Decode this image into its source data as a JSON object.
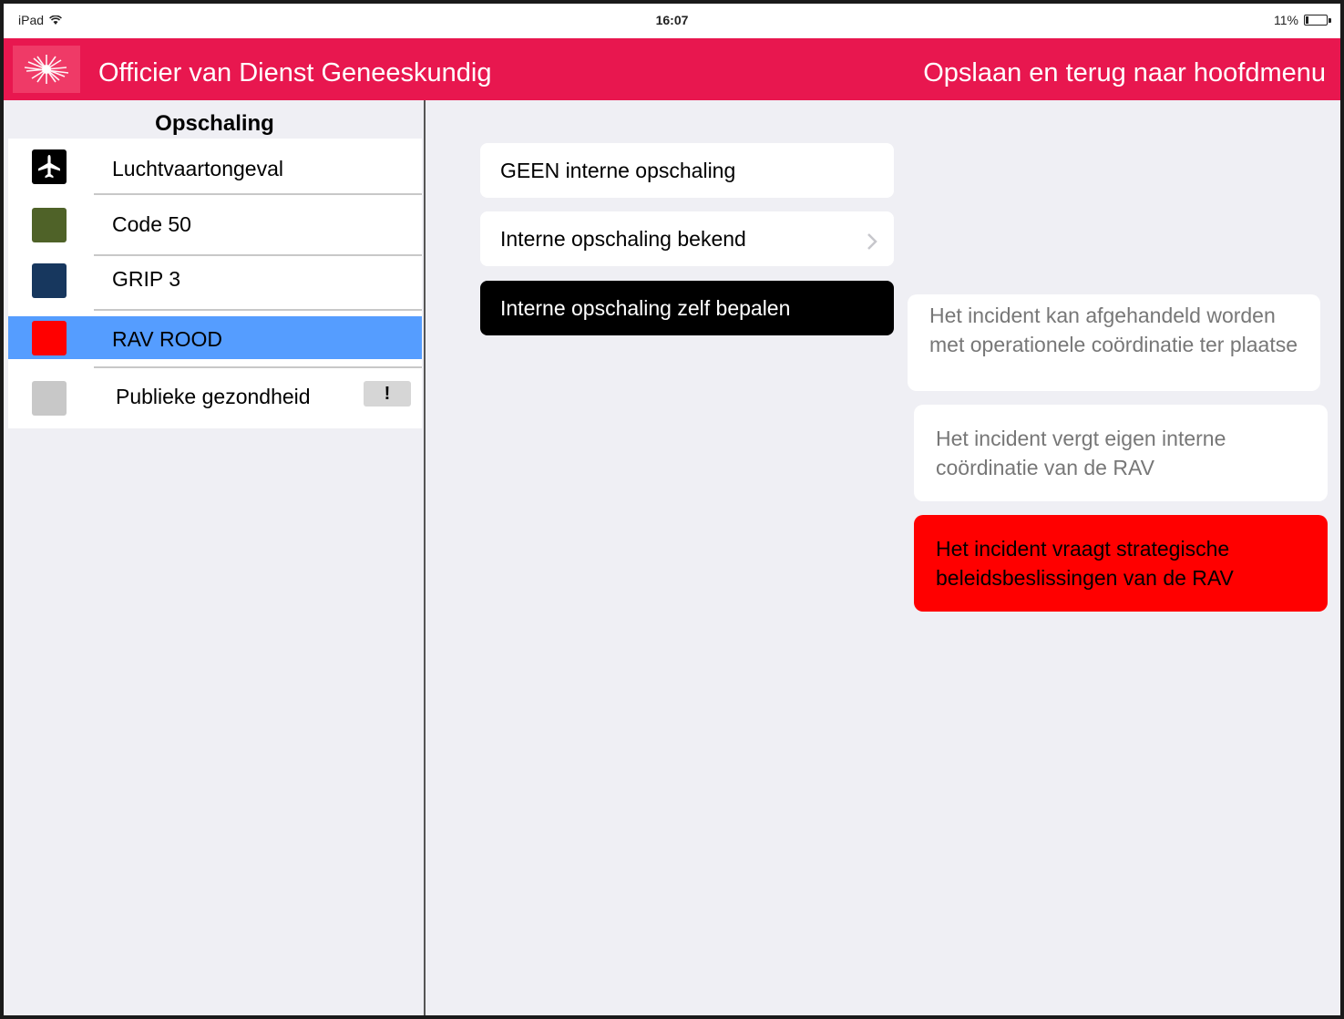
{
  "status_bar": {
    "device": "iPad",
    "time": "16:07",
    "battery": "11%",
    "battery_level": 0.11
  },
  "header": {
    "title": "Officier van Dienst Geneeskundig",
    "save_back_label": "Opslaan en terug naar hoofdmenu",
    "color": "#e8174f"
  },
  "sidebar": {
    "title": "Opschaling",
    "items": [
      {
        "label": "Luchtvaartongeval",
        "icon": "airplane-icon",
        "color": "#000000"
      },
      {
        "label": "Code 50",
        "icon": "color-swatch",
        "color": "#4f6228"
      },
      {
        "label": "GRIP 3",
        "icon": "color-swatch",
        "color": "#17375e"
      },
      {
        "label": "RAV ROOD",
        "icon": "color-swatch",
        "color": "#ff0000",
        "selected": true,
        "highlight": "#559dff"
      },
      {
        "label": "Publieke gezondheid",
        "icon": "color-swatch",
        "color": "#c8c8c8",
        "badge": "!"
      }
    ]
  },
  "options": [
    {
      "label": "GEEN interne opschaling"
    },
    {
      "label": "Interne opschaling bekend",
      "icon": "chevron-right-icon"
    },
    {
      "label": "Interne opschaling zelf bepalen",
      "selected": true
    }
  ],
  "descriptions": [
    {
      "text": "Het incident kan afgehandeld worden met operationele coördinatie ter plaatse"
    },
    {
      "text": "Het incident vergt eigen interne coördinatie van de RAV"
    },
    {
      "text": "Het incident vraagt strategische beleidsbeslissingen van de RAV",
      "selected": true,
      "color": "#ff0000"
    }
  ]
}
